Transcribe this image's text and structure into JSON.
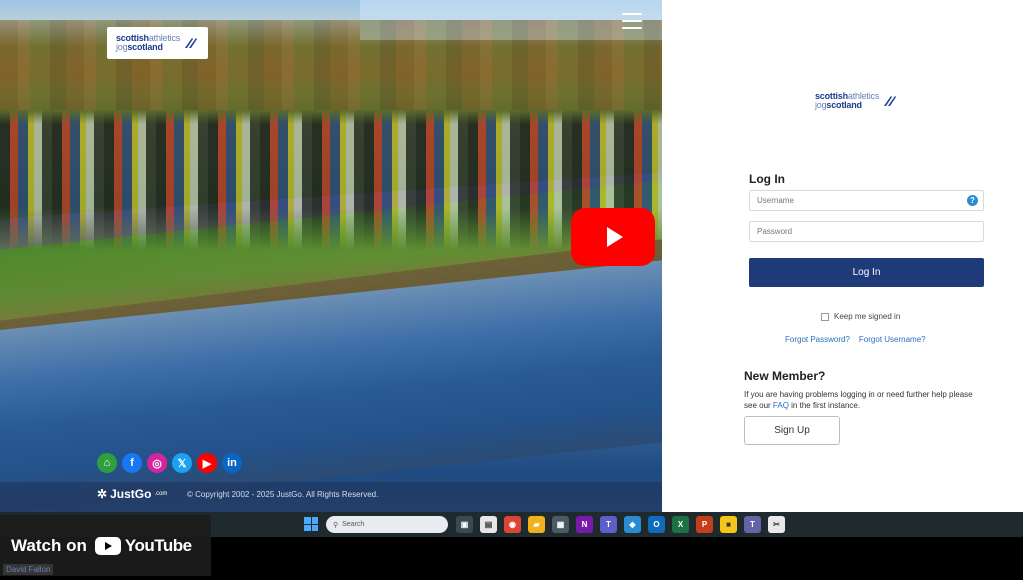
{
  "photo": {
    "logo": {
      "line1": "scottish",
      "line1_sub": "athletics",
      "line2_sub": "jog",
      "line2": "scotland"
    },
    "socials": [
      {
        "name": "home",
        "glyph": "⌂",
        "color": "#2e9e3e"
      },
      {
        "name": "facebook",
        "glyph": "f",
        "color": "#1877f2"
      },
      {
        "name": "instagram",
        "glyph": "◎",
        "color": "#d6249f"
      },
      {
        "name": "x",
        "glyph": "𝕏",
        "color": "#1da1f2"
      },
      {
        "name": "youtube",
        "glyph": "▶",
        "color": "#ff0000"
      },
      {
        "name": "linkedin",
        "glyph": "in",
        "color": "#0a66c2"
      }
    ],
    "brand": "JustGo",
    "brand_suffix": ".com",
    "copyright": "© Copyright 2002 - 2025 JustGo. All Rights Reserved."
  },
  "login": {
    "logo": {
      "line1": "scottish",
      "line1_sub": "athletics",
      "line2_sub": "jog",
      "line2": "scotland"
    },
    "title": "Log In",
    "username_placeholder": "Username",
    "password_placeholder": "Password",
    "help_glyph": "?",
    "login_button": "Log In",
    "keep_signed_in": "Keep me signed in",
    "forgot_password": "Forgot Password?",
    "forgot_username": "Forgot Username?",
    "new_member_title": "New Member?",
    "help_text_before": "If you are having problems logging in or need further help please see our ",
    "help_text_link": "FAQ",
    "help_text_after": " in the first instance.",
    "signup_button": "Sign Up"
  },
  "taskbar": {
    "search_placeholder": "Search",
    "apps": [
      {
        "name": "task-view",
        "glyph": "▣",
        "color": "#3b4a52"
      },
      {
        "name": "file",
        "glyph": "▤",
        "color": "#e6e6e6"
      },
      {
        "name": "chrome",
        "glyph": "◉",
        "color": "#db4437"
      },
      {
        "name": "file-explorer",
        "glyph": "▰",
        "color": "#f2b01e"
      },
      {
        "name": "calculator",
        "glyph": "▦",
        "color": "#4b5a63"
      },
      {
        "name": "onenote",
        "glyph": "N",
        "color": "#7719aa"
      },
      {
        "name": "teams-purple",
        "glyph": "T",
        "color": "#5b5fc7"
      },
      {
        "name": "people",
        "glyph": "◆",
        "color": "#2a8cd0"
      },
      {
        "name": "outlook",
        "glyph": "O",
        "color": "#0f6cbd"
      },
      {
        "name": "excel",
        "glyph": "X",
        "color": "#1d7044"
      },
      {
        "name": "powerpoint",
        "glyph": "P",
        "color": "#c43e1c"
      },
      {
        "name": "sticky-notes",
        "glyph": "■",
        "color": "#f5c518"
      },
      {
        "name": "teams",
        "glyph": "T",
        "color": "#6264a7"
      },
      {
        "name": "snipping-tool",
        "glyph": "✂",
        "color": "#e8e8e8"
      }
    ]
  },
  "youtube": {
    "watch_label": "Watch on",
    "brand": "YouTube",
    "channel": "David Fallon"
  }
}
